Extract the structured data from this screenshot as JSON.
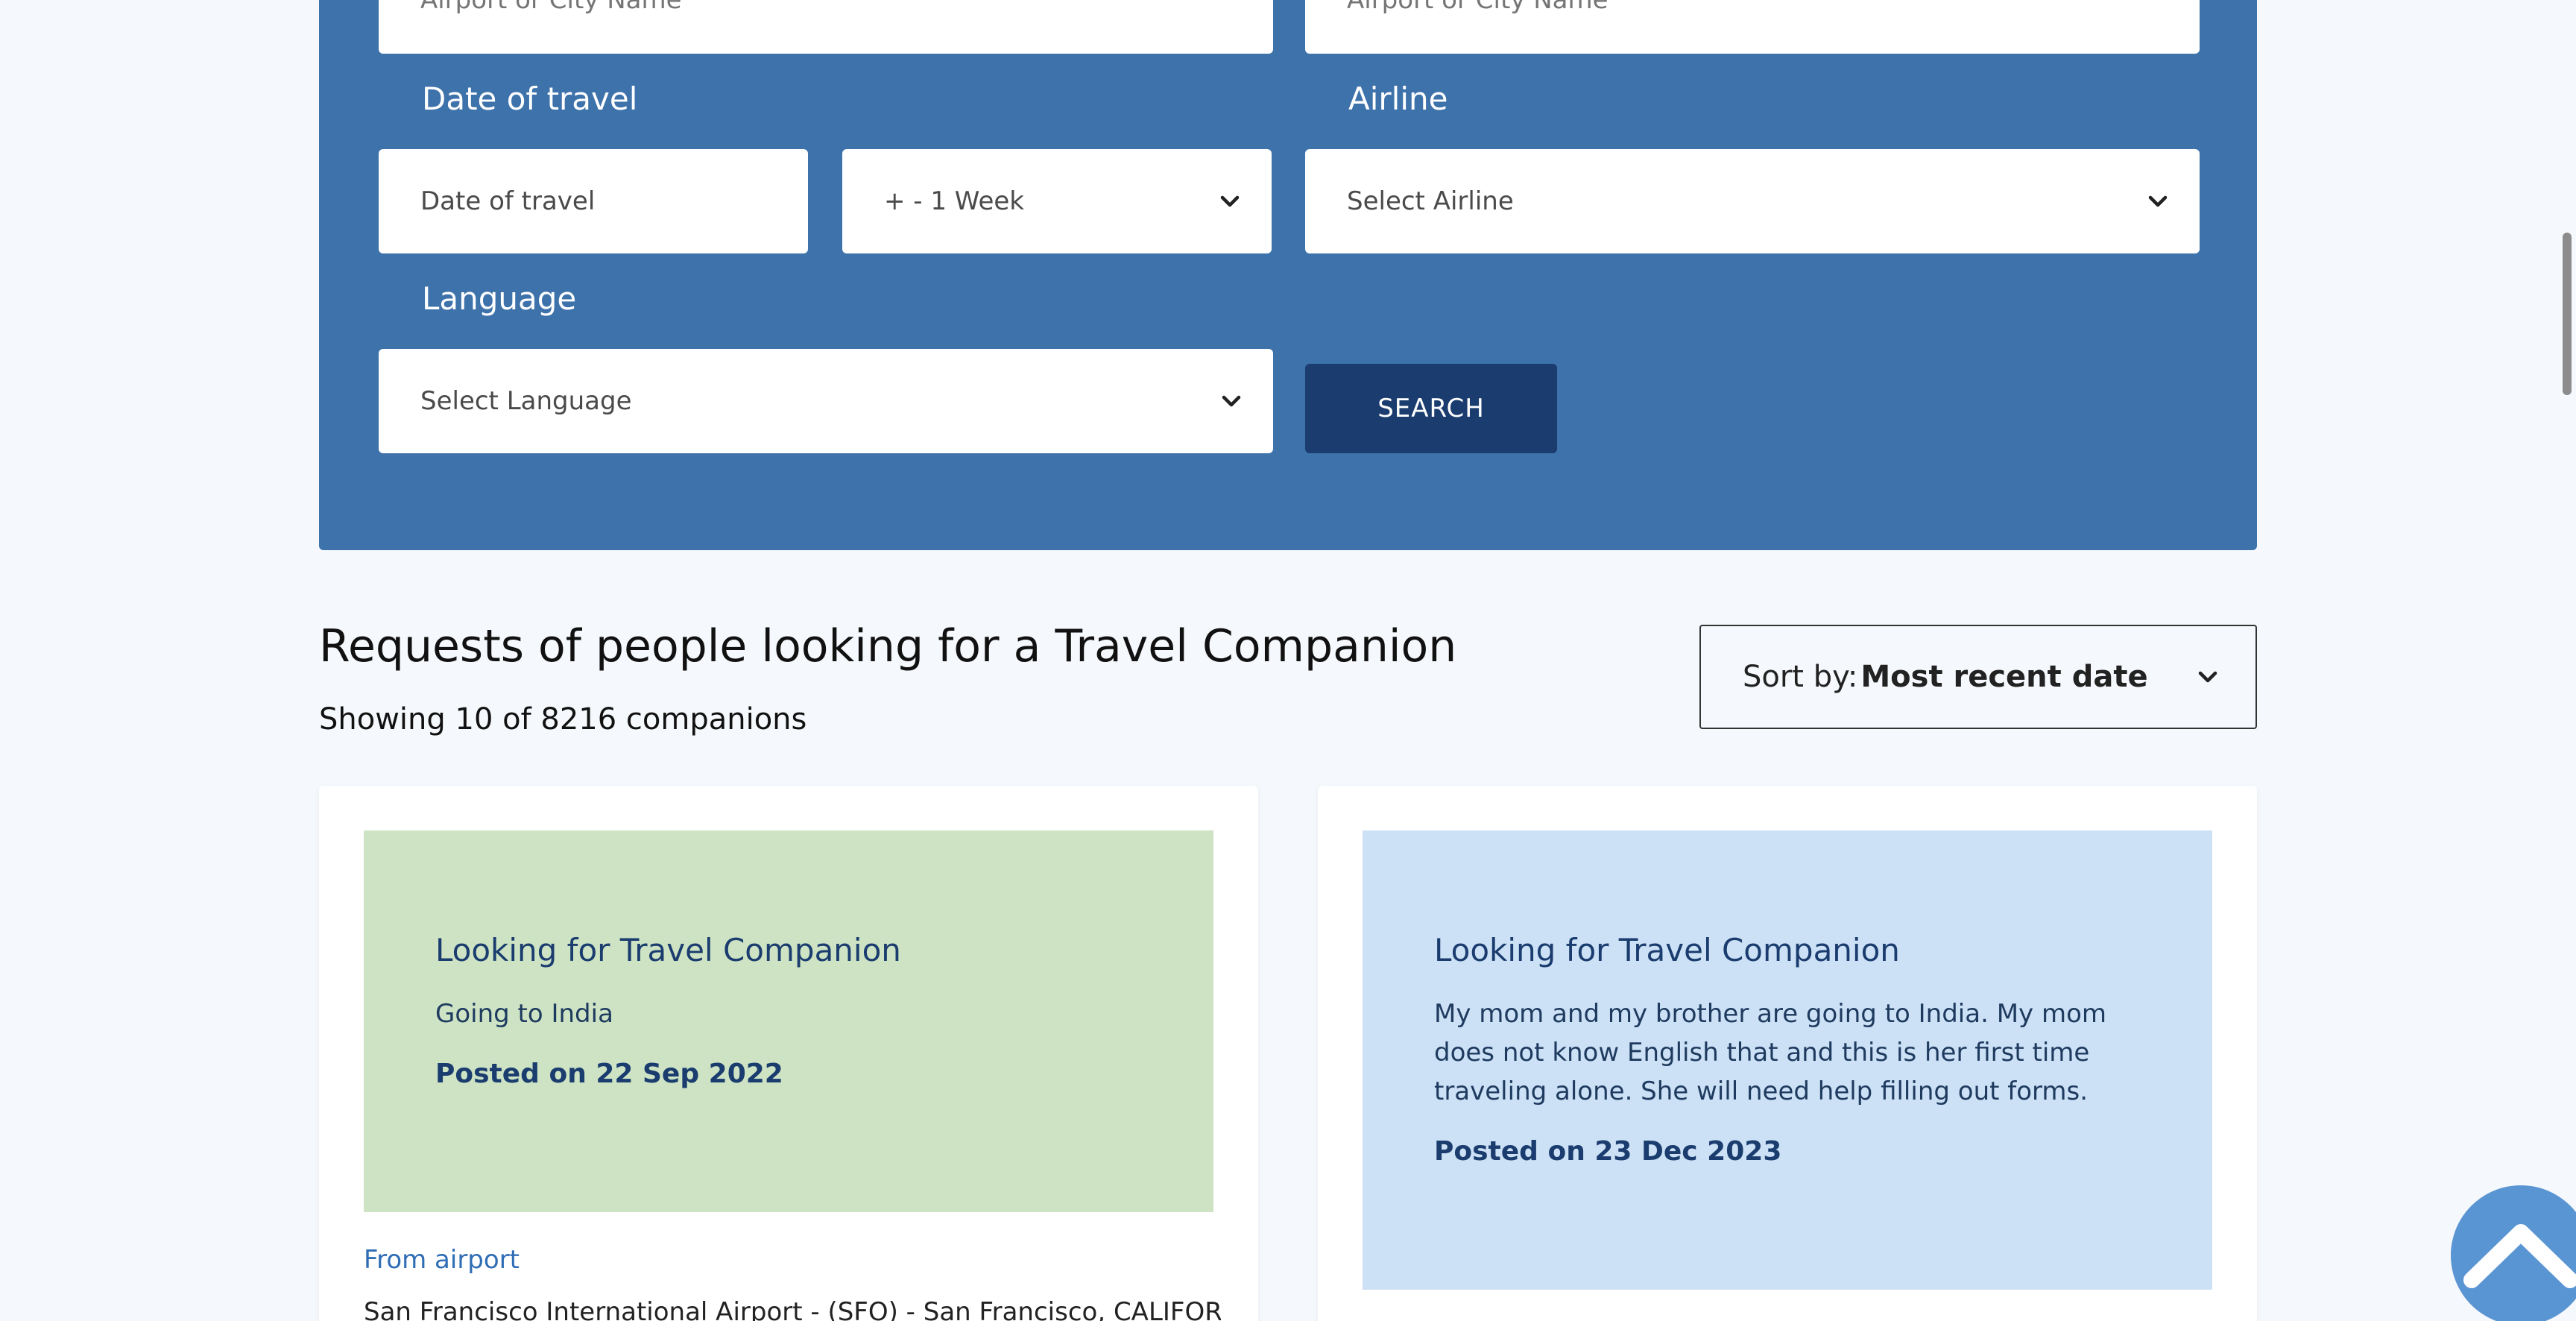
{
  "form": {
    "from_placeholder": "Airport or City Name",
    "to_placeholder": "Airport or City Name",
    "date_label": "Date of travel",
    "date_placeholder": "Date of travel",
    "flex_value": "+ - 1 Week",
    "airline_label": "Airline",
    "airline_value": "Select Airline",
    "language_label": "Language",
    "language_value": "Select Language",
    "search_label": "SEARCH"
  },
  "results": {
    "title": "Requests of people looking for a Travel Companion",
    "count_text": "Showing 10 of 8216 companions",
    "sort_prefix": "Sort by:",
    "sort_value": "Most recent date"
  },
  "cards": [
    {
      "heading": "Looking for Travel Companion",
      "body": "Going to India",
      "posted": "Posted on 22 Sep 2022",
      "from_label": "From airport",
      "from_value": "San Francisco International Airport - (SFO) - San Francisco, CALIFORNIA",
      "bg_color": "#cde3c4"
    },
    {
      "heading": "Looking for Travel Companion",
      "body": "My mom and my brother are going to India. My mom does not know English that and this is her first time traveling alone. She will need help filling out forms.",
      "posted": "Posted on 23 Dec 2023",
      "bg_color": "#cce1f5"
    }
  ],
  "colors": {
    "panel": "#3e72ab",
    "button": "#1a3c6e",
    "scroll_top": "#5a95d3"
  },
  "icons": [
    "chevron-down-icon",
    "arrow-up-icon"
  ]
}
